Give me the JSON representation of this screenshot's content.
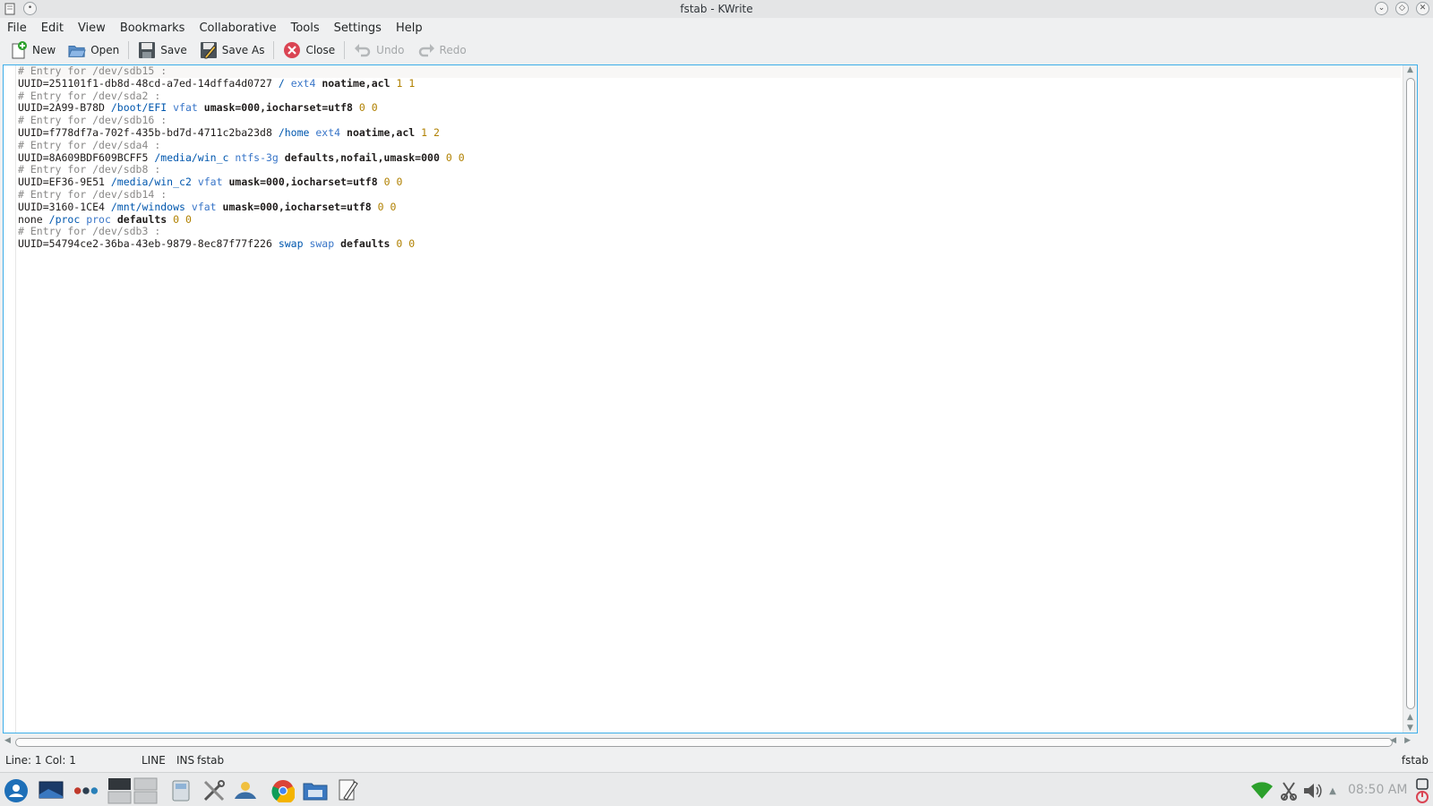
{
  "window": {
    "title": "fstab - KWrite"
  },
  "menu": [
    {
      "label": "File"
    },
    {
      "label": "Edit"
    },
    {
      "label": "View"
    },
    {
      "label": "Bookmarks"
    },
    {
      "label": "Collaborative"
    },
    {
      "label": "Tools"
    },
    {
      "label": "Settings"
    },
    {
      "label": "Help"
    }
  ],
  "toolbar": {
    "new_label": "New",
    "open_label": "Open",
    "save_label": "Save",
    "save_as_label": "Save As",
    "close_label": "Close",
    "undo_label": "Undo",
    "redo_label": "Redo"
  },
  "editor": {
    "lines": [
      {
        "comment": "# Entry for /dev/sdb15 :"
      },
      {
        "device": "UUID=251101f1-db8d-48cd-a7ed-14dffa4d0727",
        "mount": "/",
        "fstype": "ext4",
        "options": "noatime,acl",
        "dump": "1",
        "pass": "1"
      },
      {
        "comment": "# Entry for /dev/sda2 :"
      },
      {
        "device": "UUID=2A99-B78D",
        "mount": "/boot/EFI",
        "fstype": "vfat",
        "options": "umask=000,iocharset=utf8",
        "dump": "0",
        "pass": "0"
      },
      {
        "comment": "# Entry for /dev/sdb16 :"
      },
      {
        "device": "UUID=f778df7a-702f-435b-bd7d-4711c2ba23d8",
        "mount": "/home",
        "fstype": "ext4",
        "options": "noatime,acl",
        "dump": "1",
        "pass": "2"
      },
      {
        "comment": "# Entry for /dev/sda4 :"
      },
      {
        "device": "UUID=8A609BDF609BCFF5",
        "mount": "/media/win_c",
        "fstype": "ntfs-3g",
        "options": "defaults,nofail,umask=000",
        "dump": "0",
        "pass": "0"
      },
      {
        "comment": "# Entry for /dev/sdb8 :"
      },
      {
        "device": "UUID=EF36-9E51",
        "mount": "/media/win_c2",
        "fstype": "vfat",
        "options": "umask=000,iocharset=utf8",
        "dump": "0",
        "pass": "0"
      },
      {
        "comment": "# Entry for /dev/sdb14 :"
      },
      {
        "device": "UUID=3160-1CE4",
        "mount": "/mnt/windows",
        "fstype": "vfat",
        "options": "umask=000,iocharset=utf8",
        "dump": "0",
        "pass": "0"
      },
      {
        "device": "none",
        "mount": "/proc",
        "fstype": "proc",
        "options": "defaults",
        "dump": "0",
        "pass": "0"
      },
      {
        "comment": "# Entry for /dev/sdb3 :"
      },
      {
        "device": "UUID=54794ce2-36ba-43eb-9879-8ec87f77f226",
        "mount": "swap",
        "fstype": "swap",
        "options": "defaults",
        "dump": "0",
        "pass": "0"
      }
    ]
  },
  "status": {
    "position": "Line: 1 Col: 1",
    "mode": "LINE",
    "insert": "INS",
    "filetype": "fstab",
    "filename": "fstab"
  },
  "taskbar": {
    "clock": "08:50 AM"
  }
}
